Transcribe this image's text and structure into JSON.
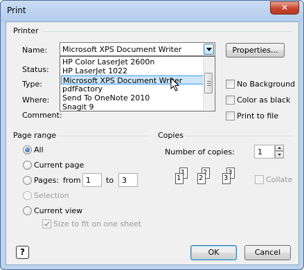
{
  "window": {
    "title": "Print",
    "close_glyph": "✕"
  },
  "printer": {
    "group_label": "Printer",
    "name_label": "Name:",
    "status_label": "Status:",
    "type_label": "Type:",
    "where_label": "Where:",
    "comment_label": "Comment:",
    "selected": "Microsoft XPS Document Writer",
    "properties_label": "Properties...",
    "options": [
      "HP Color LaserJet 2600n",
      "HP LaserJet 1022",
      "Microsoft XPS Document Writer",
      "pdfFactory",
      "Send To OneNote 2010",
      "Snagit 9"
    ],
    "no_background_label": "No Background",
    "color_as_black_label": "Color as black",
    "print_to_file_label": "Print to file"
  },
  "page_range": {
    "group_label": "Page range",
    "all_label": "All",
    "current_page_label": "Current page",
    "pages_label": "Pages:",
    "from_label": "from",
    "from_value": "1",
    "to_label": "to",
    "to_value": "3",
    "selection_label": "Selection",
    "current_view_label": "Current view",
    "size_to_fit_label": "Size to fit on one sheet"
  },
  "copies": {
    "group_label": "Copies",
    "number_label": "Number of copies:",
    "number_value": "1",
    "collate_label": "Collate",
    "page_numbers": [
      "1",
      "1",
      "2",
      "2",
      "3",
      "3"
    ]
  },
  "footer": {
    "help_glyph": "?",
    "ok_label": "OK",
    "cancel_label": "Cancel"
  }
}
